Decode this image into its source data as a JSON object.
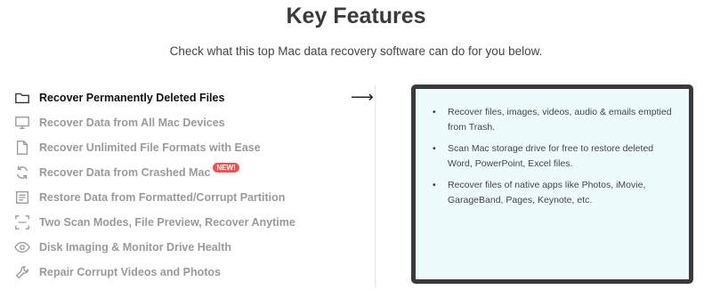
{
  "header": {
    "title": "Key Features",
    "subtitle": "Check what this top Mac data recovery software can do for you below."
  },
  "features": [
    {
      "label": "Recover Permanently Deleted Files",
      "icon": "folder-icon",
      "active": true
    },
    {
      "label": "Recover Data from All Mac Devices",
      "icon": "monitor-icon"
    },
    {
      "label": "Recover Unlimited File Formats with Ease",
      "icon": "file-icon"
    },
    {
      "label": "Recover Data from Crashed Mac",
      "icon": "refresh-icon",
      "badge": "NEW!"
    },
    {
      "label": "Restore Data from Formatted/Corrupt Partition",
      "icon": "drive-icon"
    },
    {
      "label": "Two Scan Modes, File Preview, Recover Anytime",
      "icon": "scan-icon"
    },
    {
      "label": "Disk Imaging & Monitor Drive Health",
      "icon": "eye-icon"
    },
    {
      "label": "Repair Corrupt Videos and Photos",
      "icon": "wrench-icon"
    }
  ],
  "arrow": "⟶",
  "panel": {
    "bullet": "•",
    "items": [
      "Recover files, images, videos, audio & emails emptied from Trash.",
      "Scan Mac storage drive for free to restore deleted Word, PowerPoint, Excel files.",
      "Recover files of native apps like Photos, iMovie, GarageBand, Pages, Keynote, etc."
    ]
  },
  "colors": {
    "active_text": "#111111",
    "inactive_text": "#9a9a9a",
    "panel_bg": "#eefbfd",
    "panel_border": "#3a3a3a",
    "badge_bg": "#ef5350"
  }
}
